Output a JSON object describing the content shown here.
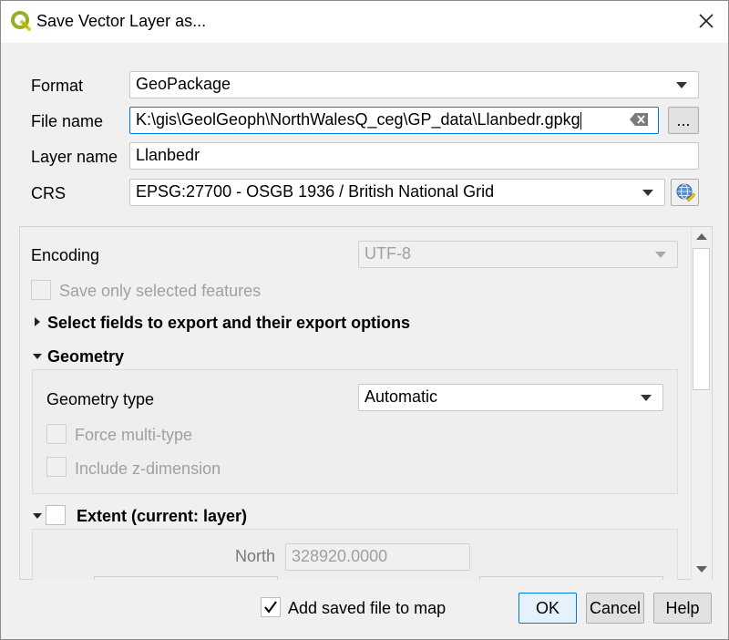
{
  "window": {
    "title": "Save Vector Layer as...",
    "icons": {
      "app": "qgis-logo-icon",
      "close": "close-icon"
    }
  },
  "form": {
    "format_label": "Format",
    "format_value": "GeoPackage",
    "filename_label": "File name",
    "filename_value": "K:\\gis\\GeolGeoph\\NorthWalesQ_ceg\\GP_data\\Llanbedr.gpkg",
    "browse_label": "...",
    "layername_label": "Layer name",
    "layername_value": "Llanbedr",
    "crs_label": "CRS",
    "crs_value": "EPSG:27700 - OSGB 1936 / British National Grid",
    "crs_icon": "globe-projection-icon"
  },
  "options": {
    "encoding_label": "Encoding",
    "encoding_value": "UTF-8",
    "save_selected_label": "Save only selected features",
    "select_fields_label": "Select fields to export and their export options",
    "geometry_label": "Geometry",
    "geometry_type_label": "Geometry type",
    "geometry_type_value": "Automatic",
    "force_multi_label": "Force multi-type",
    "include_z_label": "Include z-dimension",
    "extent_label": "Extent (current: layer)",
    "north_label": "North",
    "north_value": "328920.0000"
  },
  "footer": {
    "add_to_map_label": "Add saved file to map",
    "add_to_map_checked": true,
    "ok_label": "OK",
    "cancel_label": "Cancel",
    "help_label": "Help"
  },
  "colors": {
    "accent": "#0078d7",
    "qgis_green": "#93b023",
    "qgis_yellow": "#f0c419"
  }
}
